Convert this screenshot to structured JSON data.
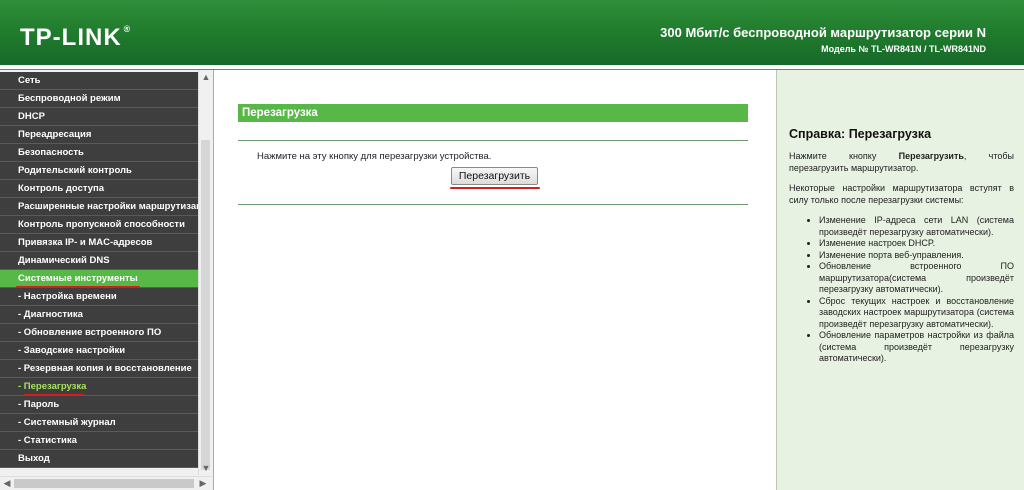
{
  "header": {
    "logo": "TP-LINK",
    "logo_mark": "®",
    "product": "300 Мбит/с беспроводной маршрутизатор серии N",
    "model": "Модель № TL-WR841N / TL-WR841ND"
  },
  "sidebar": {
    "items": [
      {
        "label": "Сеть"
      },
      {
        "label": "Беспроводной режим"
      },
      {
        "label": "DHCP"
      },
      {
        "label": "Переадресация"
      },
      {
        "label": "Безопасность"
      },
      {
        "label": "Родительский контроль"
      },
      {
        "label": "Контроль доступа"
      },
      {
        "label": "Расширенные настройки маршрутизации"
      },
      {
        "label": "Контроль пропускной способности"
      },
      {
        "label": "Привязка IP- и MAC-адресов"
      },
      {
        "label": "Динамический DNS"
      },
      {
        "label": "Системные инструменты"
      },
      {
        "label": "- Настройка времени"
      },
      {
        "label": "- Диагностика"
      },
      {
        "label": "- Обновление встроенного ПО"
      },
      {
        "label": "- Заводские настройки"
      },
      {
        "label": "- Резервная копия и восстановление"
      },
      {
        "label": "- Перезагрузка"
      },
      {
        "label": "- Пароль"
      },
      {
        "label": "- Системный журнал"
      },
      {
        "label": "- Статистика"
      },
      {
        "label": "Выход"
      }
    ],
    "active_section": "Системные инструменты",
    "current_page": "- Перезагрузка"
  },
  "main": {
    "title": "Перезагрузка",
    "instruction": "Нажмите на эту кнопку для перезагрузки устройства.",
    "reboot_button": "Перезагрузить"
  },
  "help": {
    "title": "Справка: Перезагрузка",
    "p1_a": "Нажмите кнопку ",
    "p1_b": "Перезагрузить",
    "p1_c": ", чтобы перезагрузить маршрутизатор.",
    "p2": "Некоторые настройки маршрутизатора вступят в силу только после перезагрузки системы:",
    "bullets": [
      "Изменение IP-адреса сети LAN (система произведёт перезагрузку автоматически).",
      "Изменение настроек DHCP.",
      "Изменение порта веб-управления.",
      "Обновление встроенного ПО маршрутизатора(система произведёт перезагрузку автоматически).",
      "Сброс текущих настроек и восстановление заводских настроек маршрутизатора (система произведёт перезагрузку автоматически).",
      "Обновление параметров настройки из файла (система произведёт перезагрузку автоматически)."
    ]
  },
  "colors": {
    "header_green": "#1f7a2c",
    "accent_green": "#58b847",
    "menu_dark": "#3e3e3e",
    "current_text": "#a7e35b",
    "highlight_red": "#d21e1e",
    "help_bg": "#e8f2e2"
  }
}
